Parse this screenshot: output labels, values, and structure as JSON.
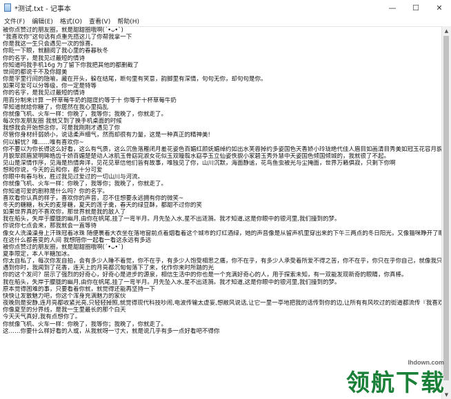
{
  "window": {
    "title": "*测试.txt - 记事本",
    "minimize": "—",
    "maximize": "☐",
    "close": "✕"
  },
  "menu": [
    "文件(F)",
    "编辑(E)",
    "格式(O)",
    "查看(V)",
    "帮助(H)"
  ],
  "lines": [
    "被你点赞过的朋友圈，就是甜甜圈哦啊(´•ᴗ•`)",
    "“我喜欢你”这句话有点重先搭这儿了你帮我拿一下",
    "你是我这一生只会遇见一次的惊喜。",
    "你眨一下眼，就翻阅了我心里的春暮秋冬",
    "你的名字，是我见过最短的情诗",
    "你知道吗我手机16g 为了留下你我把其他的都删截了",
    "世间的都说千不及你甜美",
    "你是字里行间的隐喻，藏在开头，躲在结尾，断句里有笑意，韵脚里有深情，句句无你，却句句是你。",
    "如果可爱可以分等级，你一定是特等",
    "你的名字，是我见过最短的情诗",
    "用百分制来计算 一杯草莓牛奶的甜度约等于十 你等于十杯草莓牛奶",
    "早知道就给你糖了，你居然在我心里捣乱",
    "你就像飞机、火车一样：你晚了，我等你；我晚了，你就走了。",
    "每次你发朋友圈 我就又到了换手机桌面的时候",
    "我想我会开始想念你，可是我刚刚才遇见了你",
    "尽管你身材纤弱娇小，说话柔声细气，然而却很有力量，这是一种真正的精神美!",
    "何以解忧？唯……唯有喜欢你~",
    "你不要以为你长得这么好看，这么有气质，这么沉鱼落雁闭月羞花姿色百媚红颜妩媚绰约如出水芙蓉掉约多姿国色天香娇小玲珑绝代佳人眉目如画清目秀美如冠玉花容月貌，我就……",
    "月貌翠颜眉黛明眸皓齿千娇百媚楚楚动人冰肌玉骨窈窕淑女花似玉双瞳翦水窈亭玉立仙姿佚貌小家碧玉秀外慧中天姿国色倾国倾城的，我就很了不起。",
    "见山是深情作序，见海是热情奔洋，见花见草信他们皆有故事，唯独见了你，山川沉默，海面静谧，花鸟鱼虫被光与尘掩面，世界万籁俱寂，只剩下你啊",
    "想和你说，今天的云和你，都十分可爱",
    "你眼中有春与秋，胜过我见过爱过的一切山川与河流。",
    "你就像飞机、火车一样：你晚了，我等你；我晚了，你就走了。",
    "你知道可爱的剧称是什么吗？你的名字。",
    "喜欢看你认真的样子，喜欢你的声音，忍不住想要永远拥有你的微笑~",
    "冬天的糖糖，秋天的麦芽糖，夏天的莲子羹，春天的绿豆酥，都甜不过你的笑",
    "如果世界真的不喜欢你，那世界就是我的敌人了",
    "我在船头，失岸于朦胧的幽月,由你在帆尾,挂了一弯半月。月先坠入水,星不出涟漪。我才知道,这是你眼中的银河里,我们撞到的梦。",
    "你说你七点会来，那我就会一直等待",
    "像女人洗澡澡身上汗珠冠着冰珠 随便裹着大衣坐在落地窗前点着烟看着这个城市的灯红酒绿，她的声音像是从留声机里穿出来的下午三两点的冬日阳光，又像猫咪睁开了眼睛。",
    "在这什么都善变的人间 我想陪你一起看一看这永远有多远",
    "被你点赞过的朋友圈，就是甜甜圈哦啊(´•ᴗ•`)",
    "夏季限定，本人半糖加冰。",
    "你太自私了，每次你发自拍，会有多少人睡不着觉，你不在乎，有多少人饱受相思之痛，你不在乎，有多少人承受着所爱不得之苦，你不在乎，你只在乎你自己，就像我只在乎你一样自私",
    "遇到你时，我闻到了花香，连天上的月亮都沉甸甸落下了来，化作你来时所踏的光",
    "你的这个发问？层示了强烈的好奇心，好奇心是进步的源泉，相信生活中的你也是一个充满好奇心的人，用于探索未知，有一双能发现新奇的眼睛，你真棒。",
    "我在船头，失岸于朦胧的幽月,由你在帆尾,挂了一弯半月。月先坠入水,星不出涟漪。我才知道,这是你眼中的银河里,我们撞到的梦。",
    "原本觉得困难的事，只要看着你就，就觉得还能再坚持一下",
    "快快让发散魅力吧，你这个浑身充满魅力的家伙",
    "夜晚则是安静,连月亮都收紧光亮,只轻轻掉照,就觉得现代科技吵闹,电波传输太虚妄,想敝风说话,让它一里一亭地把我的话传到你的边,让所有有风吹过的街道都流传『我喜欢你』的语言。",
    "你像夏至的分界线，是我一生里最长的那个白天",
    "今天天气真好,我有点想你了。",
    "你就像飞机、火车一样：你晚了，我等你；我晚了，你就走了。",
    "这……你要什么样好看的人或，从我就呀一寸大，就是说几乎有多一点好看吧不得你"
  ],
  "watermark": {
    "site": "lhdown.com",
    "brand": "领航下载"
  }
}
